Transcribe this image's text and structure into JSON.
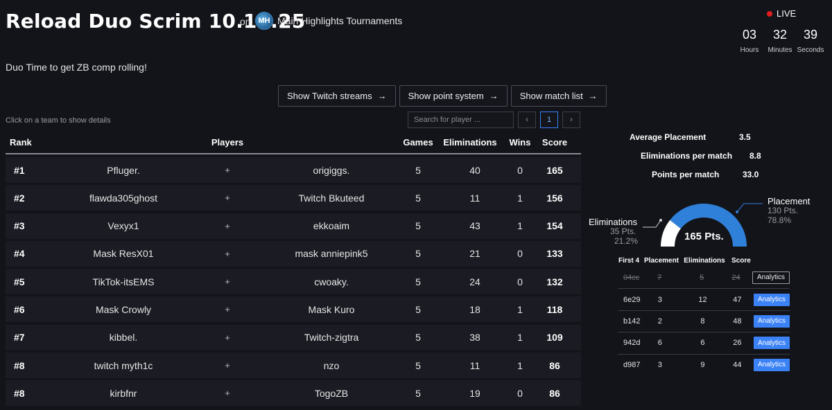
{
  "header": {
    "title": "Reload Duo Scrim 10.10.25",
    "on_label": "on",
    "org_logo_text": "MH",
    "org_name": "Main Highlights Tournaments",
    "live_label": "LIVE",
    "countdown": [
      {
        "value": "03",
        "label": "Hours"
      },
      {
        "value": "32",
        "label": "Minutes"
      },
      {
        "value": "39",
        "label": "Seconds"
      }
    ],
    "subtitle": "Duo Time to get ZB comp rolling!"
  },
  "toolbar": {
    "buttons": [
      {
        "label": "Show Twitch streams",
        "icon": "arrow-right-icon"
      },
      {
        "label": "Show point system",
        "icon": "arrow-right-icon"
      },
      {
        "label": "Show match list",
        "icon": "arrow-right-icon"
      }
    ],
    "hint": "Click on a team to show details",
    "search_placeholder": "Search for player ...",
    "pager": {
      "prev": "‹",
      "current": "1",
      "next": "›"
    }
  },
  "table": {
    "headers": {
      "rank": "Rank",
      "players": "Players",
      "games": "Games",
      "eliminations": "Eliminations",
      "wins": "Wins",
      "score": "Score"
    },
    "plus": "+",
    "rows": [
      {
        "rank": "#1",
        "p1": "Pfluger.",
        "p2": "origiggs.",
        "games": "5",
        "elims": "40",
        "wins": "0",
        "score": "165"
      },
      {
        "rank": "#2",
        "p1": "flawda305ghost",
        "p2": "Twitch Bkuteed",
        "games": "5",
        "elims": "11",
        "wins": "1",
        "score": "156"
      },
      {
        "rank": "#3",
        "p1": "Vexyx1",
        "p2": "ekkoaim",
        "games": "5",
        "elims": "43",
        "wins": "1",
        "score": "154"
      },
      {
        "rank": "#4",
        "p1": "Mask ResX01",
        "p2": "mask anniepink5",
        "games": "5",
        "elims": "21",
        "wins": "0",
        "score": "133"
      },
      {
        "rank": "#5",
        "p1": "TikTok-itsEMS",
        "p2": "cwoaky.",
        "games": "5",
        "elims": "24",
        "wins": "0",
        "score": "132"
      },
      {
        "rank": "#6",
        "p1": "Mask Crowly",
        "p2": "Mask Kuro",
        "games": "5",
        "elims": "18",
        "wins": "1",
        "score": "118"
      },
      {
        "rank": "#7",
        "p1": "kibbel.",
        "p2": "Twitch-zigtra",
        "games": "5",
        "elims": "38",
        "wins": "1",
        "score": "109"
      },
      {
        "rank": "#8",
        "p1": "twitch myth1c",
        "p2": "nzo",
        "games": "5",
        "elims": "11",
        "wins": "1",
        "score": "86"
      },
      {
        "rank": "#8",
        "p1": "kirbfnr",
        "p2": "TogoZB",
        "games": "5",
        "elims": "19",
        "wins": "0",
        "score": "86"
      }
    ]
  },
  "details": {
    "stats": [
      {
        "label": "Average Placement",
        "value": "3.5"
      },
      {
        "label": "Eliminations per match",
        "value": "8.8"
      },
      {
        "label": "Points per match",
        "value": "33.0"
      }
    ],
    "gauge": {
      "total": "165 Pts.",
      "eliminations": {
        "label": "Eliminations",
        "pts": "35 Pts.",
        "pct": "21.2%",
        "fraction": 0.212,
        "color": "#ffffff"
      },
      "placement": {
        "label": "Placement",
        "pts": "130 Pts.",
        "pct": "78.8%",
        "fraction": 0.788,
        "color": "#2f80d8"
      }
    },
    "matches": {
      "headers": {
        "first4": "First 4",
        "placement": "Placement",
        "eliminations": "Eliminations",
        "score": "Score"
      },
      "rows": [
        {
          "id": "04cc",
          "placement": "7",
          "elims": "5",
          "score": "24",
          "button": "Analytics",
          "struck": true
        },
        {
          "id": "6e29",
          "placement": "3",
          "elims": "12",
          "score": "47",
          "button": "Analytics",
          "struck": false
        },
        {
          "id": "b142",
          "placement": "2",
          "elims": "8",
          "score": "48",
          "button": "Analytics",
          "struck": false
        },
        {
          "id": "942d",
          "placement": "6",
          "elims": "6",
          "score": "26",
          "button": "Analytics",
          "struck": false
        },
        {
          "id": "d987",
          "placement": "3",
          "elims": "9",
          "score": "44",
          "button": "Analytics",
          "struck": false
        }
      ]
    }
  }
}
